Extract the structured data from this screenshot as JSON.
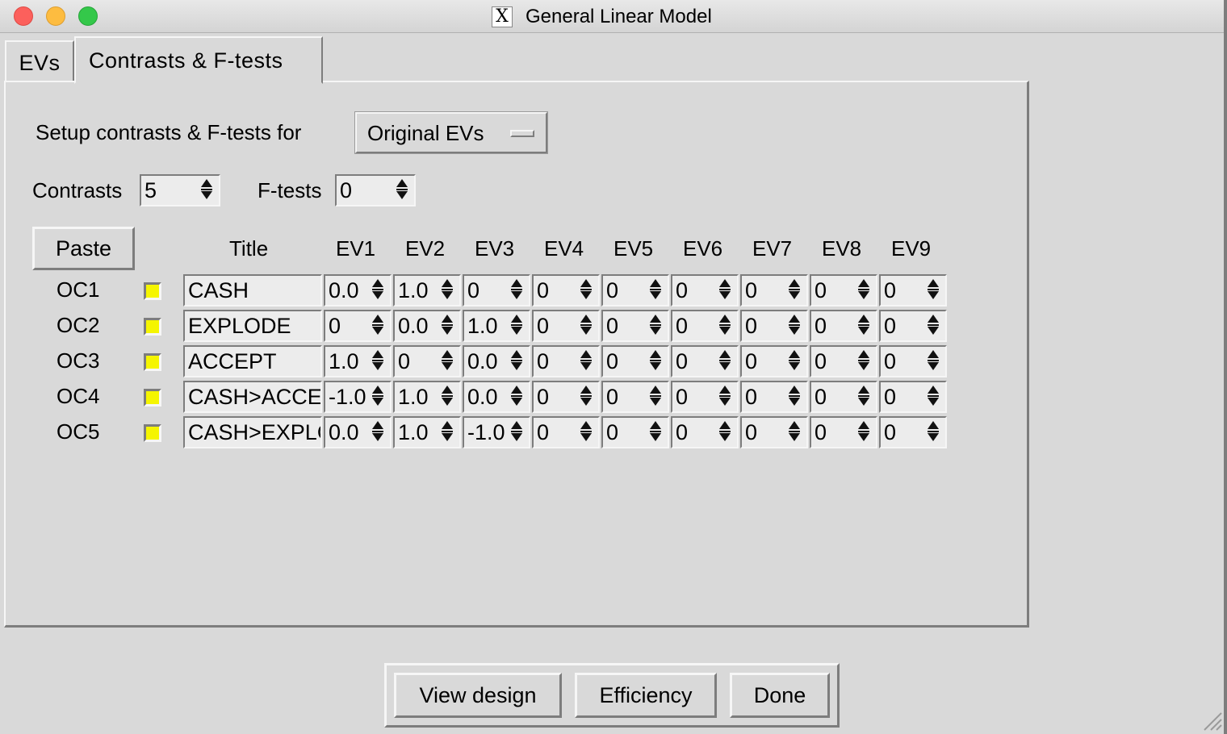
{
  "window": {
    "title": "General Linear Model"
  },
  "tabs": [
    {
      "label": "EVs",
      "active": false
    },
    {
      "label": "Contrasts & F-tests",
      "active": true
    }
  ],
  "setup": {
    "label": "Setup contrasts & F-tests for",
    "selected": "Original EVs"
  },
  "counts": {
    "contrasts_label": "Contrasts",
    "contrasts_value": "5",
    "ftests_label": "F-tests",
    "ftests_value": "0"
  },
  "table": {
    "paste_label": "Paste",
    "title_header": "Title",
    "ev_headers": [
      "EV1",
      "EV2",
      "EV3",
      "EV4",
      "EV5",
      "EV6",
      "EV7",
      "EV8",
      "EV9"
    ],
    "rows": [
      {
        "label": "OC1",
        "title": "CASH",
        "values": [
          "0.0",
          "1.0",
          "0",
          "0",
          "0",
          "0",
          "0",
          "0",
          "0"
        ]
      },
      {
        "label": "OC2",
        "title": "EXPLODE",
        "values": [
          "0",
          "0.0",
          "1.0",
          "0",
          "0",
          "0",
          "0",
          "0",
          "0"
        ]
      },
      {
        "label": "OC3",
        "title": "ACCEPT",
        "values": [
          "1.0",
          "0",
          "0.0",
          "0",
          "0",
          "0",
          "0",
          "0",
          "0"
        ]
      },
      {
        "label": "OC4",
        "title": "CASH>ACCEPT",
        "values": [
          "-1.0",
          "1.0",
          "0.0",
          "0",
          "0",
          "0",
          "0",
          "0",
          "0"
        ]
      },
      {
        "label": "OC5",
        "title": "CASH>EXPLODE",
        "values": [
          "0.0",
          "1.0",
          "-1.0",
          "0",
          "0",
          "0",
          "0",
          "0",
          "0"
        ]
      }
    ]
  },
  "buttons": {
    "view_design": "View design",
    "efficiency": "Efficiency",
    "done": "Done"
  },
  "colors": {
    "window_bg": "#d9d9d9",
    "indicator": "#f5f500"
  }
}
